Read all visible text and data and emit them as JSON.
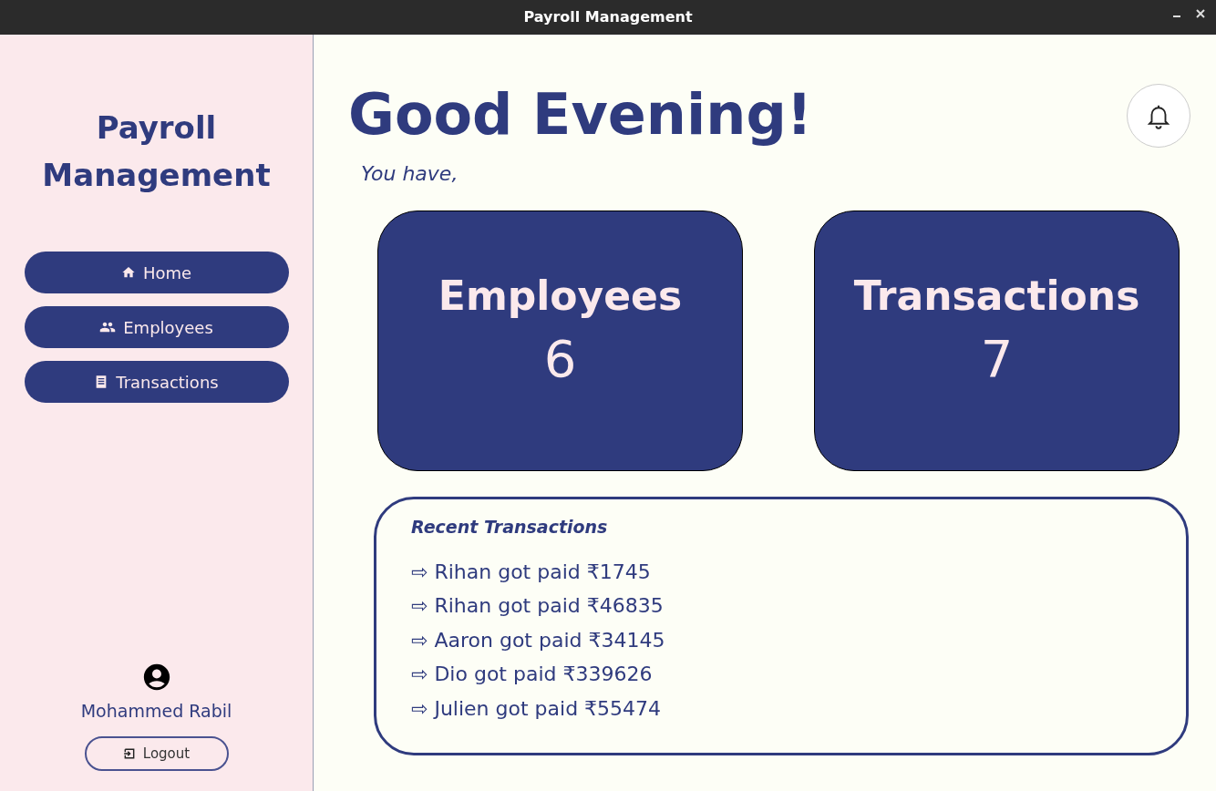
{
  "window": {
    "title": "Payroll Management"
  },
  "sidebar": {
    "title": "Payroll Management",
    "nav": [
      {
        "label": "Home",
        "kind": "home"
      },
      {
        "label": "Employees",
        "kind": "people"
      },
      {
        "label": "Transactions",
        "kind": "list"
      }
    ],
    "user": {
      "name": "Mohammed Rabil"
    },
    "logout": "Logout"
  },
  "greeting": "Good Evening!",
  "subtitle": "You have,",
  "stats": [
    {
      "label": "Employees",
      "value": "6"
    },
    {
      "label": "Transactions",
      "value": "7"
    }
  ],
  "recent": {
    "title": "Recent Transactions",
    "items": [
      "⇨ Rihan got paid ₹1745",
      "⇨ Rihan got paid ₹46835",
      "⇨ Aaron got paid ₹34145",
      "⇨ Dio got paid ₹339626",
      "⇨ Julien got paid ₹55474"
    ]
  }
}
